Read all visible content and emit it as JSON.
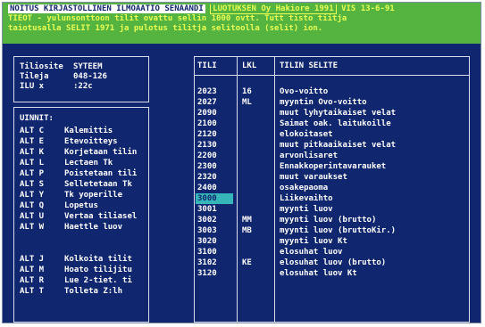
{
  "topbar": {
    "line1_title": "NOITUS KIRJASTOLLINEN ILMOAATIO SENAANDI",
    "line1_box": "LUOTUKSEN Oy Hakiore 1991",
    "line1_right": "VIS 13-6-91",
    "line2": "TIEOT - yulunsonttoon tilit ovattu sellin 1000 ovtt. Tutt tisto tiitja",
    "line3": "taiotusalla SELIT 1971 ja pulotus tilitja selitoolla (selit) ion."
  },
  "info": {
    "rows": [
      {
        "label": "Tiliosite",
        "value": "SYTEEM"
      },
      {
        "label": "Tileja",
        "value": "048-126"
      },
      {
        "label": "ILU x",
        "value": ":22c"
      }
    ]
  },
  "menu": {
    "header": "UINNIT:",
    "group1": [
      {
        "key": "ALT C",
        "label": "Kalemittis"
      },
      {
        "key": "ALT E",
        "label": "Etevoitteys"
      },
      {
        "key": "ALT K",
        "label": "Korjetaan tilin"
      },
      {
        "key": "ALT L",
        "label": "Lectaen Tk"
      },
      {
        "key": "ALT P",
        "label": "Poistetaan tili"
      },
      {
        "key": "ALT S",
        "label": "Selletetaan Tk"
      },
      {
        "key": "ALT Y",
        "label": "Tk yoperille"
      },
      {
        "key": "ALT Q",
        "label": "Lopetus"
      },
      {
        "key": "ALT U",
        "label": "Vertaa tiliasel"
      },
      {
        "key": "ALT W",
        "label": "Haettle luov"
      }
    ],
    "group2": [
      {
        "key": "ALT J",
        "label": "Kolkoita tilit"
      },
      {
        "key": "ALT M",
        "label": "Hoato tilijitu"
      },
      {
        "key": "ALT R",
        "label": "Lue 2-tiet. ti"
      },
      {
        "key": "ALT T",
        "label": "Tolleta Z:lh"
      }
    ]
  },
  "table": {
    "headers": [
      "TILI",
      "LKL",
      "TILIN SELITE"
    ],
    "rows": [
      {
        "tili": "2023",
        "lkl": "16",
        "selite": "Ovo-voitto"
      },
      {
        "tili": "2027",
        "lkl": "ML",
        "selite": "myyntin Ovo-voitto"
      },
      {
        "tili": "2090",
        "lkl": "",
        "selite": "muut lyhytaikaiset velat"
      },
      {
        "tili": "2100",
        "lkl": "",
        "selite": "Saimat oak. laitukoille"
      },
      {
        "tili": "2120",
        "lkl": "",
        "selite": "elokoitaset"
      },
      {
        "tili": "2130",
        "lkl": "",
        "selite": "muut pitkaaikaiset velat"
      },
      {
        "tili": "2200",
        "lkl": "",
        "selite": "arvonlisaret"
      },
      {
        "tili": "2300",
        "lkl": "",
        "selite": "Ennakkoperintavarauket"
      },
      {
        "tili": "2320",
        "lkl": "",
        "selite": "muut varaukset"
      },
      {
        "tili": "2400",
        "lkl": "",
        "selite": "osakepaoma"
      },
      {
        "tili": "3000",
        "lkl": "",
        "selite": "Liikevaihto"
      },
      {
        "tili": "3001",
        "lkl": "",
        "selite": "myynti luov"
      },
      {
        "tili": "3002",
        "lkl": "MM",
        "selite": "myynti luov (brutto)"
      },
      {
        "tili": "3003",
        "lkl": "MB",
        "selite": "myynti luov (bruttoKir.)"
      },
      {
        "tili": "3020",
        "lkl": "",
        "selite": "myynti luov Kt"
      },
      {
        "tili": "3100",
        "lkl": "",
        "selite": "elosuhat luov"
      },
      {
        "tili": "3102",
        "lkl": "KE",
        "selite": "elosuhat luov (brutto)"
      },
      {
        "tili": "3120",
        "lkl": "",
        "selite": "elosuhat luov Kt"
      }
    ]
  },
  "colors": {
    "background": "#10266e",
    "topbar": "#55b33f",
    "topbar_text": "#e9ff55",
    "selection": "#37b6b9",
    "text": "#ffffff"
  }
}
